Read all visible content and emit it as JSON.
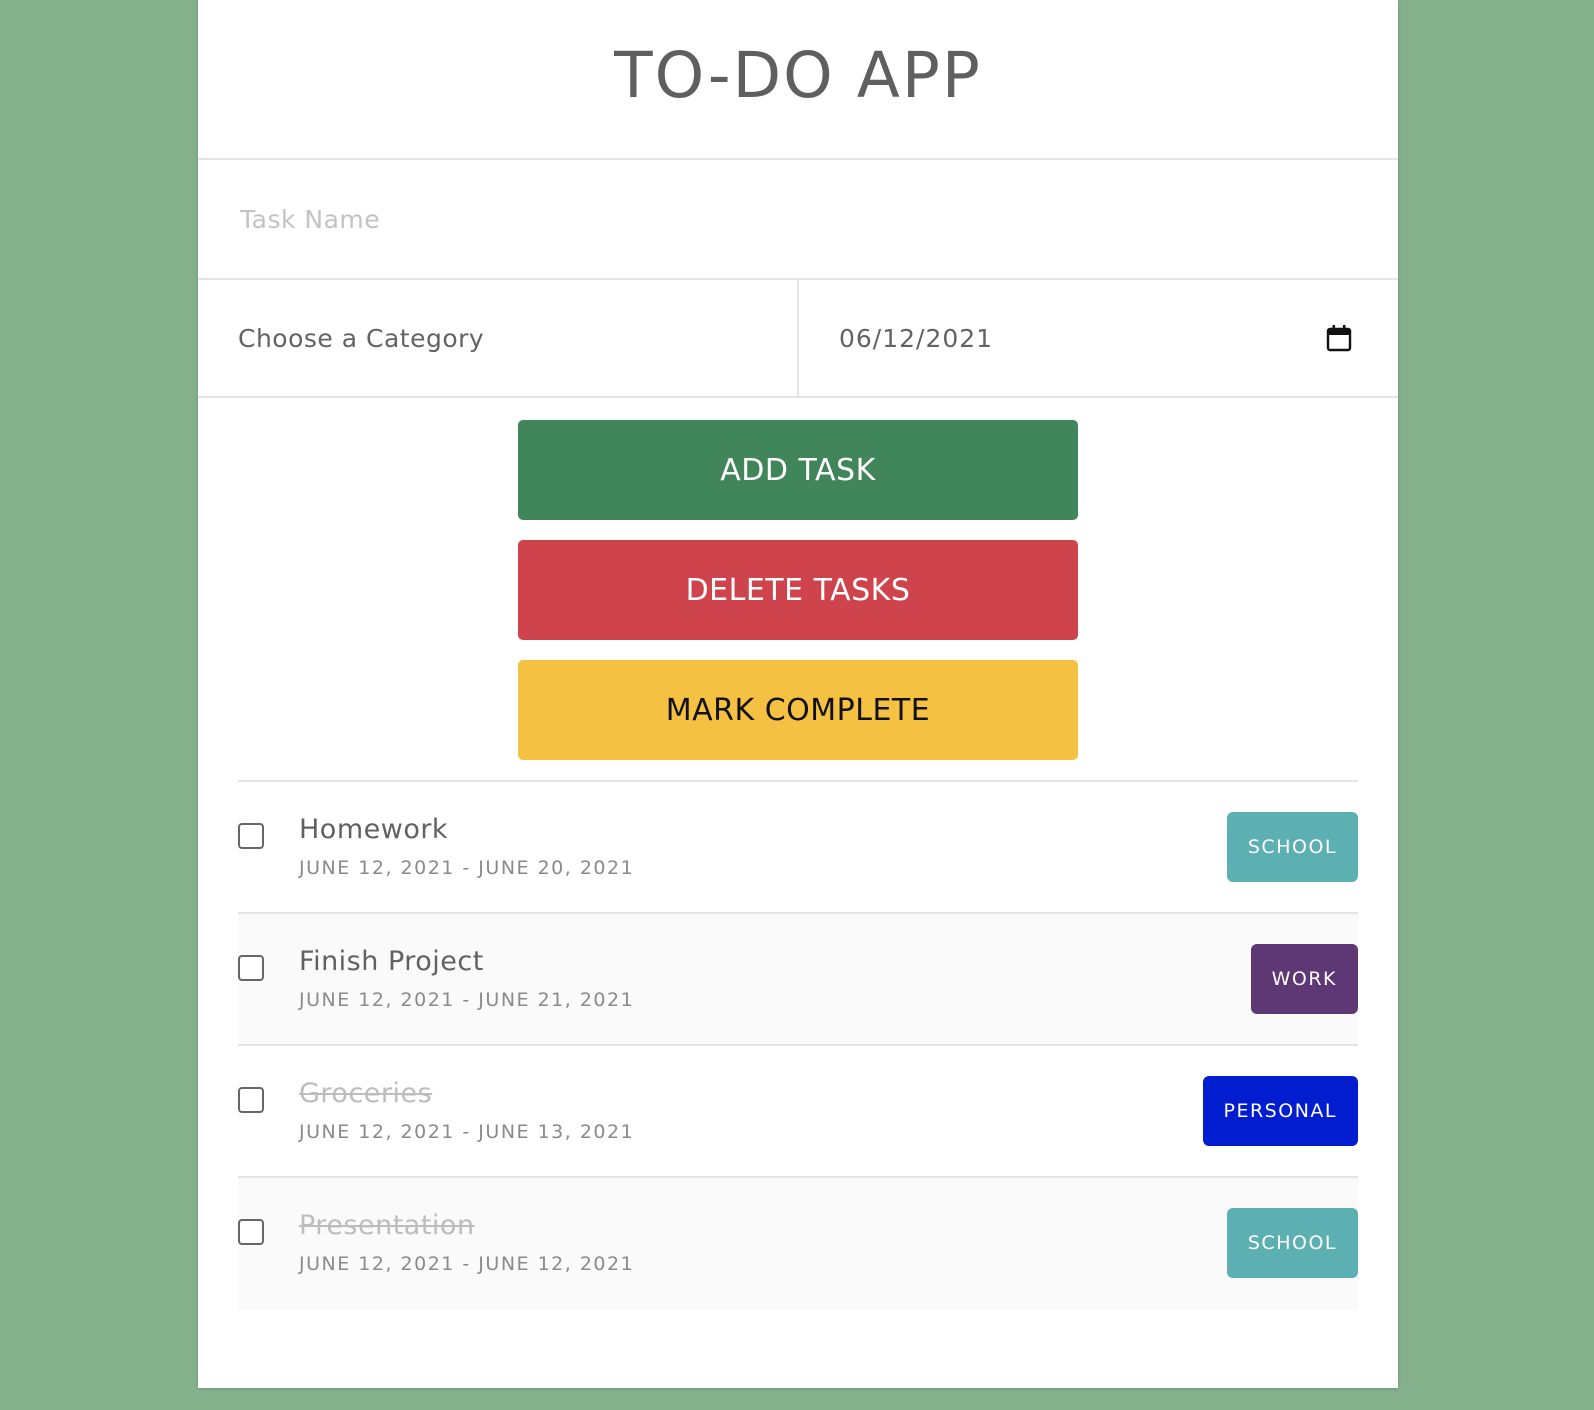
{
  "app": {
    "title": "TO-DO APP"
  },
  "form": {
    "task_name_placeholder": "Task Name",
    "task_name_value": "",
    "category_label": "Choose a Category",
    "date_value": "06/12/2021"
  },
  "buttons": {
    "add_task": "ADD TASK",
    "delete_tasks": "DELETE TASKS",
    "mark_complete": "MARK COMPLETE"
  },
  "tasks": [
    {
      "name": "Homework",
      "dates": "JUNE 12, 2021 - JUNE 20, 2021",
      "category": "SCHOOL",
      "completed": false,
      "checked": false
    },
    {
      "name": "Finish Project",
      "dates": "JUNE 12, 2021 - JUNE 21, 2021",
      "category": "WORK",
      "completed": false,
      "checked": false
    },
    {
      "name": "Groceries",
      "dates": "JUNE 12, 2021 - JUNE 13, 2021",
      "category": "PERSONAL",
      "completed": true,
      "checked": false
    },
    {
      "name": "Presentation",
      "dates": "JUNE 12, 2021 - JUNE 12, 2021",
      "category": "SCHOOL",
      "completed": true,
      "checked": false
    }
  ],
  "colors": {
    "background": "#84b08c",
    "add_button": "#41855a",
    "delete_button": "#cf444c",
    "mark_button": "#f5c142",
    "badge_school": "#5cb0b2",
    "badge_work": "#5e3775",
    "badge_personal": "#021ccf"
  },
  "icons": {
    "date_picker": "calendar-icon"
  }
}
